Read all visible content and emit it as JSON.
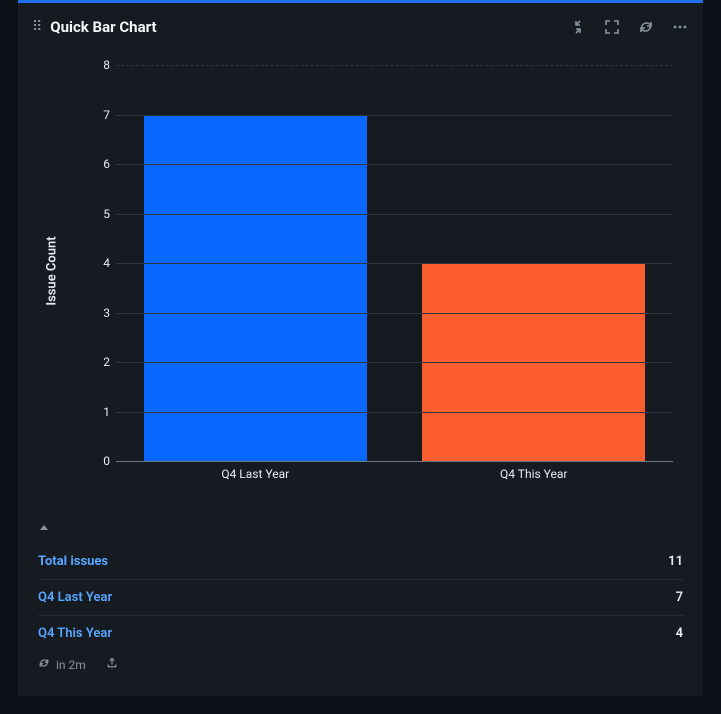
{
  "panel": {
    "title": "Quick Bar Chart"
  },
  "chart_data": {
    "type": "bar",
    "categories": [
      "Q4 Last Year",
      "Q4 This Year"
    ],
    "values": [
      7,
      4
    ],
    "colors": [
      "#0969ff",
      "#fb5d2e"
    ],
    "ylabel": "Issue Count",
    "ylim": [
      0,
      8
    ],
    "yticks": [
      0,
      1,
      2,
      3,
      4,
      5,
      6,
      7,
      8
    ]
  },
  "summary": {
    "total_label": "Total issues",
    "total_value": "11",
    "rows": [
      {
        "label": "Q4 Last Year",
        "value": "7"
      },
      {
        "label": "Q4 This Year",
        "value": "4"
      }
    ]
  },
  "footer": {
    "refresh_text": "in 2m"
  }
}
